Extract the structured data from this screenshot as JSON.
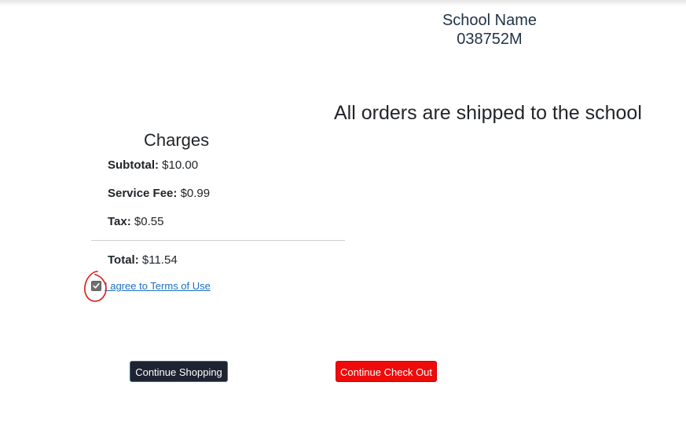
{
  "header": {
    "school_name": "School Name",
    "school_code": "038752M",
    "shipping_note": "All orders are shipped to the school"
  },
  "charges": {
    "title": "Charges",
    "subtotal_label": "Subtotal:",
    "subtotal_value": "$10.00",
    "service_fee_label": "Service Fee:",
    "service_fee_value": "$0.99",
    "tax_label": "Tax:",
    "tax_value": "$0.55",
    "total_label": "Total:",
    "total_value": "$11.54"
  },
  "terms": {
    "checked": true,
    "link_text": "I agree to Terms of Use"
  },
  "buttons": {
    "continue_shopping": "Continue Shopping",
    "continue_checkout": "Continue Check Out"
  },
  "colors": {
    "checkout_button": "#ef0b0b",
    "shopping_button": "#1d2331",
    "link": "#1a6fc4",
    "annotation": "#e01818"
  }
}
